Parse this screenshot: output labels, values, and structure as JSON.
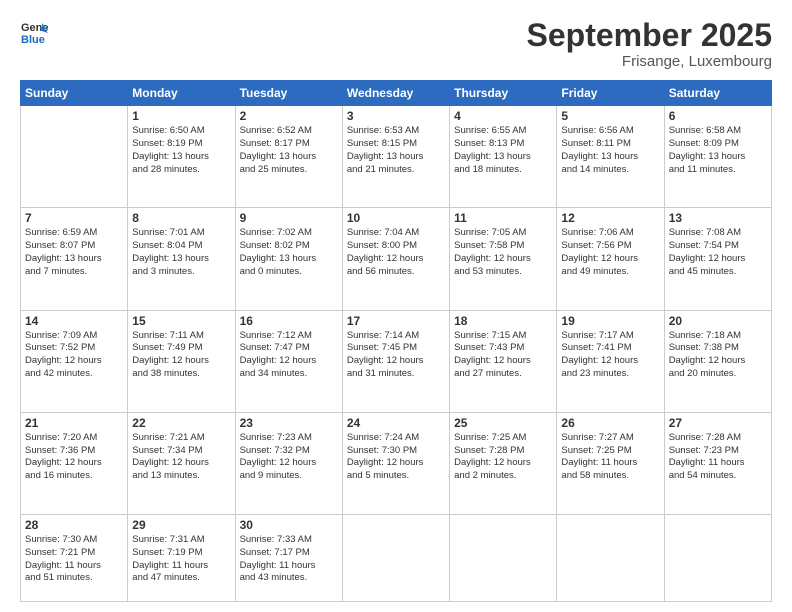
{
  "header": {
    "logo_line1": "General",
    "logo_line2": "Blue",
    "month": "September 2025",
    "location": "Frisange, Luxembourg"
  },
  "days_of_week": [
    "Sunday",
    "Monday",
    "Tuesday",
    "Wednesday",
    "Thursday",
    "Friday",
    "Saturday"
  ],
  "weeks": [
    [
      {
        "num": "",
        "info": ""
      },
      {
        "num": "1",
        "info": "Sunrise: 6:50 AM\nSunset: 8:19 PM\nDaylight: 13 hours\nand 28 minutes."
      },
      {
        "num": "2",
        "info": "Sunrise: 6:52 AM\nSunset: 8:17 PM\nDaylight: 13 hours\nand 25 minutes."
      },
      {
        "num": "3",
        "info": "Sunrise: 6:53 AM\nSunset: 8:15 PM\nDaylight: 13 hours\nand 21 minutes."
      },
      {
        "num": "4",
        "info": "Sunrise: 6:55 AM\nSunset: 8:13 PM\nDaylight: 13 hours\nand 18 minutes."
      },
      {
        "num": "5",
        "info": "Sunrise: 6:56 AM\nSunset: 8:11 PM\nDaylight: 13 hours\nand 14 minutes."
      },
      {
        "num": "6",
        "info": "Sunrise: 6:58 AM\nSunset: 8:09 PM\nDaylight: 13 hours\nand 11 minutes."
      }
    ],
    [
      {
        "num": "7",
        "info": "Sunrise: 6:59 AM\nSunset: 8:07 PM\nDaylight: 13 hours\nand 7 minutes."
      },
      {
        "num": "8",
        "info": "Sunrise: 7:01 AM\nSunset: 8:04 PM\nDaylight: 13 hours\nand 3 minutes."
      },
      {
        "num": "9",
        "info": "Sunrise: 7:02 AM\nSunset: 8:02 PM\nDaylight: 13 hours\nand 0 minutes."
      },
      {
        "num": "10",
        "info": "Sunrise: 7:04 AM\nSunset: 8:00 PM\nDaylight: 12 hours\nand 56 minutes."
      },
      {
        "num": "11",
        "info": "Sunrise: 7:05 AM\nSunset: 7:58 PM\nDaylight: 12 hours\nand 53 minutes."
      },
      {
        "num": "12",
        "info": "Sunrise: 7:06 AM\nSunset: 7:56 PM\nDaylight: 12 hours\nand 49 minutes."
      },
      {
        "num": "13",
        "info": "Sunrise: 7:08 AM\nSunset: 7:54 PM\nDaylight: 12 hours\nand 45 minutes."
      }
    ],
    [
      {
        "num": "14",
        "info": "Sunrise: 7:09 AM\nSunset: 7:52 PM\nDaylight: 12 hours\nand 42 minutes."
      },
      {
        "num": "15",
        "info": "Sunrise: 7:11 AM\nSunset: 7:49 PM\nDaylight: 12 hours\nand 38 minutes."
      },
      {
        "num": "16",
        "info": "Sunrise: 7:12 AM\nSunset: 7:47 PM\nDaylight: 12 hours\nand 34 minutes."
      },
      {
        "num": "17",
        "info": "Sunrise: 7:14 AM\nSunset: 7:45 PM\nDaylight: 12 hours\nand 31 minutes."
      },
      {
        "num": "18",
        "info": "Sunrise: 7:15 AM\nSunset: 7:43 PM\nDaylight: 12 hours\nand 27 minutes."
      },
      {
        "num": "19",
        "info": "Sunrise: 7:17 AM\nSunset: 7:41 PM\nDaylight: 12 hours\nand 23 minutes."
      },
      {
        "num": "20",
        "info": "Sunrise: 7:18 AM\nSunset: 7:38 PM\nDaylight: 12 hours\nand 20 minutes."
      }
    ],
    [
      {
        "num": "21",
        "info": "Sunrise: 7:20 AM\nSunset: 7:36 PM\nDaylight: 12 hours\nand 16 minutes."
      },
      {
        "num": "22",
        "info": "Sunrise: 7:21 AM\nSunset: 7:34 PM\nDaylight: 12 hours\nand 13 minutes."
      },
      {
        "num": "23",
        "info": "Sunrise: 7:23 AM\nSunset: 7:32 PM\nDaylight: 12 hours\nand 9 minutes."
      },
      {
        "num": "24",
        "info": "Sunrise: 7:24 AM\nSunset: 7:30 PM\nDaylight: 12 hours\nand 5 minutes."
      },
      {
        "num": "25",
        "info": "Sunrise: 7:25 AM\nSunset: 7:28 PM\nDaylight: 12 hours\nand 2 minutes."
      },
      {
        "num": "26",
        "info": "Sunrise: 7:27 AM\nSunset: 7:25 PM\nDaylight: 11 hours\nand 58 minutes."
      },
      {
        "num": "27",
        "info": "Sunrise: 7:28 AM\nSunset: 7:23 PM\nDaylight: 11 hours\nand 54 minutes."
      }
    ],
    [
      {
        "num": "28",
        "info": "Sunrise: 7:30 AM\nSunset: 7:21 PM\nDaylight: 11 hours\nand 51 minutes."
      },
      {
        "num": "29",
        "info": "Sunrise: 7:31 AM\nSunset: 7:19 PM\nDaylight: 11 hours\nand 47 minutes."
      },
      {
        "num": "30",
        "info": "Sunrise: 7:33 AM\nSunset: 7:17 PM\nDaylight: 11 hours\nand 43 minutes."
      },
      {
        "num": "",
        "info": ""
      },
      {
        "num": "",
        "info": ""
      },
      {
        "num": "",
        "info": ""
      },
      {
        "num": "",
        "info": ""
      }
    ]
  ]
}
